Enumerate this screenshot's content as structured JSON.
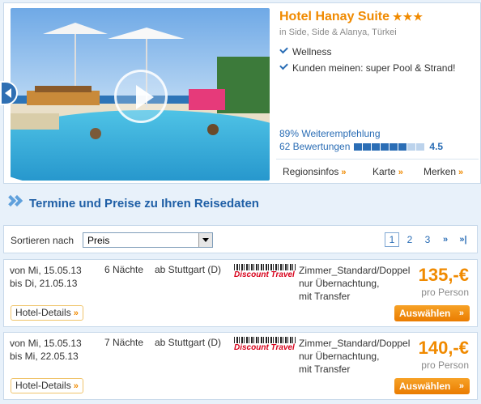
{
  "hotel": {
    "name": "Hotel Hanay Suite",
    "stars": "★★★",
    "location": "in Side, Side & Alanya, Türkei",
    "features": [
      "Wellness",
      "Kunden meinen: super Pool & Strand!"
    ],
    "recommendation": "89% Weiterempfehlung",
    "reviews": "62 Bewertungen",
    "rating_fraction": 0.75,
    "score": "4.5",
    "links": [
      {
        "label": "Regionsinfos",
        "arrow": "»"
      },
      {
        "label": "Karte",
        "arrow": "»"
      },
      {
        "label": "Merken",
        "arrow": "»"
      }
    ]
  },
  "section": {
    "title": "Termine und Preise zu Ihren Reisedaten"
  },
  "sort": {
    "label": "Sortieren nach",
    "selected": "Preis"
  },
  "pager": {
    "pages": [
      "1",
      "2",
      "3"
    ],
    "current": "1",
    "next": "»",
    "last": "»|"
  },
  "offers": [
    {
      "date_from": "von Mi, 15.05.13",
      "date_to": "bis Di, 21.05.13",
      "nights": "6 Nächte",
      "departure": "ab Stuttgart (D)",
      "operator": "Discount Travel",
      "room_lines": [
        "Zimmer_Standard/Doppel",
        "nur Übernachtung,",
        "mit Transfer"
      ],
      "price": "135,-€",
      "per": "pro Person",
      "details_label": "Hotel-Details",
      "select_label": "Auswählen",
      "arrow": "»"
    },
    {
      "date_from": "von Mi, 15.05.13",
      "date_to": "bis Mi, 22.05.13",
      "nights": "7 Nächte",
      "departure": "ab Stuttgart (D)",
      "operator": "Discount Travel",
      "room_lines": [
        "Zimmer_Standard/Doppel",
        "nur Übernachtung,",
        "mit Transfer"
      ],
      "price": "140,-€",
      "per": "pro Person",
      "details_label": "Hotel-Details",
      "select_label": "Auswählen",
      "arrow": "»"
    }
  ],
  "colors": {
    "accent_orange": "#f08a00",
    "link_blue": "#2a6db5",
    "heading_blue": "#1f5fa6"
  }
}
